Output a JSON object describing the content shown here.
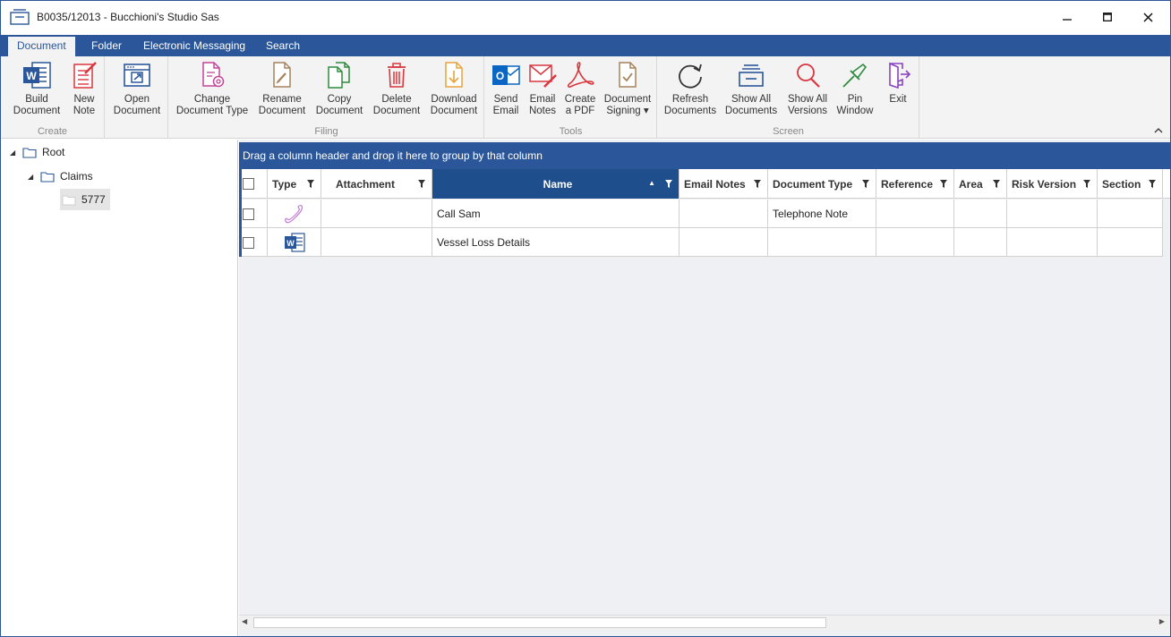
{
  "window": {
    "title": "B0035/12013 - Bucchioni's Studio Sas",
    "minimize_icon": "minimize-icon",
    "maximize_icon": "maximize-icon",
    "close_icon": "close-icon"
  },
  "tabs": [
    {
      "label": "Document",
      "active": true
    },
    {
      "label": "Folder",
      "active": false
    },
    {
      "label": "Electronic Messaging",
      "active": false
    },
    {
      "label": "Search",
      "active": false
    }
  ],
  "ribbon": {
    "groups": {
      "create": "Create",
      "filing": "Filing",
      "tools": "Tools",
      "screen": "Screen"
    },
    "buttons": {
      "build_document": {
        "line1": "Build",
        "line2": "Document"
      },
      "new_note": {
        "line1": "New",
        "line2": "Note"
      },
      "open_document": {
        "line1": "Open",
        "line2": "Document"
      },
      "change_document_type": {
        "line1": "Change",
        "line2": "Document Type"
      },
      "rename_document": {
        "line1": "Rename",
        "line2": "Document"
      },
      "copy_document": {
        "line1": "Copy",
        "line2": "Document"
      },
      "delete_document": {
        "line1": "Delete",
        "line2": "Document"
      },
      "download_document": {
        "line1": "Download",
        "line2": "Document"
      },
      "send_email": {
        "line1": "Send",
        "line2": "Email"
      },
      "email_notes": {
        "line1": "Email",
        "line2": "Notes"
      },
      "create_pdf": {
        "line1": "Create",
        "line2": "a PDF"
      },
      "document_signing": {
        "line1": "Document",
        "line2": "Signing ▾"
      },
      "refresh_documents": {
        "line1": "Refresh",
        "line2": "Documents"
      },
      "show_all_documents": {
        "line1": "Show All",
        "line2": "Documents"
      },
      "show_all_versions": {
        "line1": "Show All",
        "line2": "Versions"
      },
      "pin_window": {
        "line1": "Pin",
        "line2": "Window"
      },
      "exit": {
        "line1": "Exit",
        "line2": ""
      }
    },
    "collapse_glyph": "^"
  },
  "tree": {
    "root": "Root",
    "claims": "Claims",
    "item": "5777"
  },
  "grid": {
    "group_panel_text": "Drag a column header and drop it here to group by that column",
    "columns": {
      "type": "Type",
      "attachment": "Attachment",
      "name": "Name",
      "email_notes": "Email Notes",
      "document_type": "Document Type",
      "reference": "Reference",
      "area": "Area",
      "risk_version": "Risk Version",
      "section": "Section"
    },
    "sort": {
      "column": "name",
      "direction": "ascending",
      "glyph": "▲"
    },
    "rows": [
      {
        "type_icon": "telephone-icon",
        "attachment": "",
        "name": "Call Sam",
        "email_notes": "",
        "document_type": "Telephone Note",
        "reference": "",
        "area": "",
        "risk_version": "",
        "section": ""
      },
      {
        "type_icon": "word-document-icon",
        "attachment": "",
        "name": "Vessel Loss Details",
        "email_notes": "",
        "document_type": "",
        "reference": "",
        "area": "",
        "risk_version": "",
        "section": ""
      }
    ]
  },
  "colors": {
    "accent": "#2b579a",
    "sorted_header": "#1f4e8c",
    "grid_background": "#eef0f4"
  }
}
